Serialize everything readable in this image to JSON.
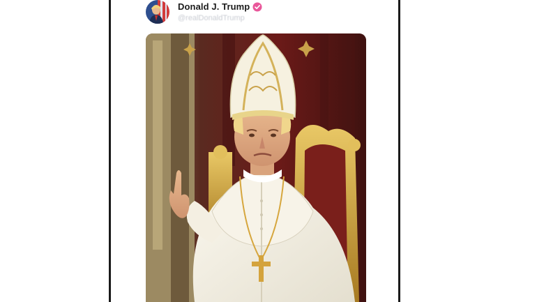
{
  "post": {
    "author": {
      "display_name": "Donald J. Trump",
      "handle": "@realDonaldTrump",
      "verified": true,
      "avatar_icon": "profile-avatar"
    },
    "image": {
      "icon": "pope-portrait-image"
    }
  },
  "colors": {
    "verified_badge": "#e9579a",
    "name_text": "#1b1b1b",
    "handle_text": "#c9ccd3",
    "card_border": "#1a1a1a"
  }
}
